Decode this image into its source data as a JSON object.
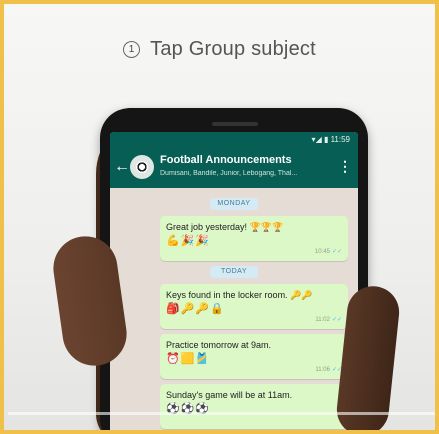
{
  "tutorial": {
    "step_number": "1",
    "caption": "Tap Group subject"
  },
  "status_bar": {
    "indicators": "▾◢ ▮ 11:59"
  },
  "chat_header": {
    "title": "Football Announcements",
    "subtitle": "Dumisani, Bandile, Junior, Lebogang, Thal...",
    "back_icon": "arrow-left-icon",
    "menu_icon": "more-vertical-icon"
  },
  "messages": {
    "date_1": "MONDAY",
    "msg_1": {
      "text": "Great job yesterday! 🏆🏆🏆",
      "emojis": "💪🎉🎉",
      "time": "10:45"
    },
    "date_2": "TODAY",
    "msg_2": {
      "text": "Keys found in the locker room. 🔑🔑",
      "emojis": "🎒🔑🔑🔒",
      "time": "11:02"
    },
    "msg_3": {
      "text": "Practice tomorrow at 9am.",
      "emojis": "⏰🟨🎽",
      "time": "11:06"
    },
    "msg_4": {
      "text": "Sunday's game will be at 11am.",
      "emojis": "⚽⚽⚽",
      "time": ""
    }
  },
  "colors": {
    "header": "#075e54",
    "bubble": "#dcf8c6",
    "chat_bg": "#e5ddd5",
    "frame": "#f0c04a"
  }
}
